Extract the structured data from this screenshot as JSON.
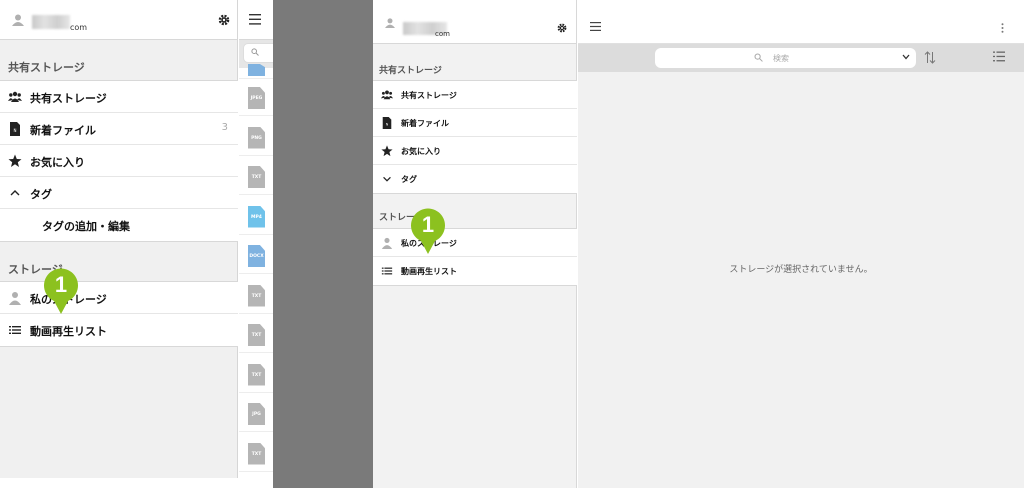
{
  "left": {
    "header": {
      "email_suffix": "com"
    },
    "section_shared": "共有ストレージ",
    "shared_items": [
      {
        "label": "共有ストレージ",
        "icon": "group-icon"
      },
      {
        "label": "新着ファイル",
        "icon": "new-file-icon",
        "count": "3"
      },
      {
        "label": "お気に入り",
        "icon": "star-icon"
      },
      {
        "label": "タグ",
        "icon": "chevron-up-icon"
      },
      {
        "label": "タグの追加・編集"
      }
    ],
    "section_storage": "ストレージ",
    "storage_items": [
      {
        "label": "私のストレージ",
        "icon": "person-icon"
      },
      {
        "label": "動画再生リスト",
        "icon": "list-icon"
      }
    ],
    "files": [
      "",
      "JPEG",
      "PNG",
      "TXT",
      "MP4",
      "DOCX",
      "TXT",
      "TXT",
      "TXT",
      "JPG",
      "TXT"
    ]
  },
  "right": {
    "header": {
      "email_suffix": "com"
    },
    "section_shared": "共有ストレージ",
    "shared_items": [
      {
        "label": "共有ストレージ",
        "icon": "group-icon"
      },
      {
        "label": "新着ファイル",
        "icon": "new-file-icon"
      },
      {
        "label": "お気に入り",
        "icon": "star-icon"
      },
      {
        "label": "タグ",
        "icon": "chevron-down-icon"
      }
    ],
    "section_storage": "ストレージ",
    "storage_items": [
      {
        "label": "私のストレージ",
        "icon": "person-icon"
      },
      {
        "label": "動画再生リスト",
        "icon": "list-icon"
      }
    ],
    "search_placeholder": "検索",
    "empty_message": "ストレージが選択されていません。"
  },
  "markers": {
    "left": "1",
    "right": "1"
  },
  "colors": {
    "marker_green": "#8cc11f",
    "file_gray": "#b5b5b5",
    "file_blue": "#6fc2ea",
    "file_docx_blue": "#7fb2e0"
  }
}
